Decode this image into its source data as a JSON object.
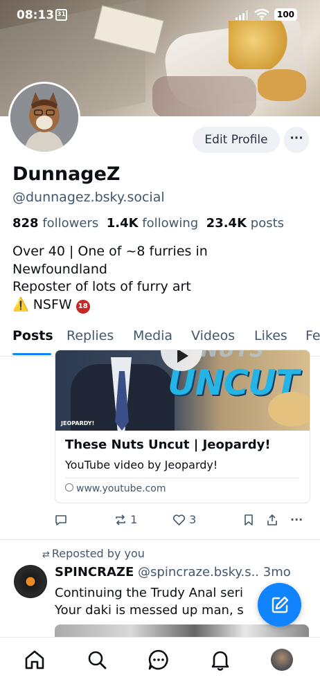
{
  "status_bar": {
    "time": "08:13",
    "calendar_day": "31",
    "battery": "100"
  },
  "profile": {
    "display_name": "DunnageZ",
    "handle": "@dunnagez.bsky.social",
    "edit_label": "Edit Profile",
    "more_label": "···",
    "followers_count": "828",
    "followers_label": "followers",
    "following_count": "1.4K",
    "following_label": "following",
    "posts_count": "23.4K",
    "posts_label": "posts",
    "bio_lines": [
      "Over 40 | One of ~8 furries in",
      "Newfoundland",
      "Reposter of lots of furry art"
    ],
    "bio_nsfw": "NSFW"
  },
  "tabs": [
    {
      "label": "Posts",
      "active": true
    },
    {
      "label": "Replies"
    },
    {
      "label": "Media"
    },
    {
      "label": "Videos"
    },
    {
      "label": "Likes"
    },
    {
      "label": "Fe"
    }
  ],
  "post1": {
    "embed": {
      "thumbnail_text": "UNCUT",
      "thumbnail_top_text": "NUTS",
      "thumbnail_badge": "JEOPARDY!",
      "title": "These Nuts Uncut | Jeopardy!",
      "description": "YouTube video by Jeopardy!",
      "link": "www.youtube.com"
    },
    "reposts": "1",
    "likes": "3"
  },
  "post2": {
    "repost_label": "Reposted by you",
    "author": "SPINCRAZE",
    "handle": "@spincraze.bsky.s..",
    "time": "3mo",
    "line1": "Continuing the Trudy Anal seri",
    "line2": "Your daki is messed up man, s"
  },
  "colors": {
    "accent": "#1083fe",
    "muted": "#42576c",
    "text": "#0b0f14"
  }
}
